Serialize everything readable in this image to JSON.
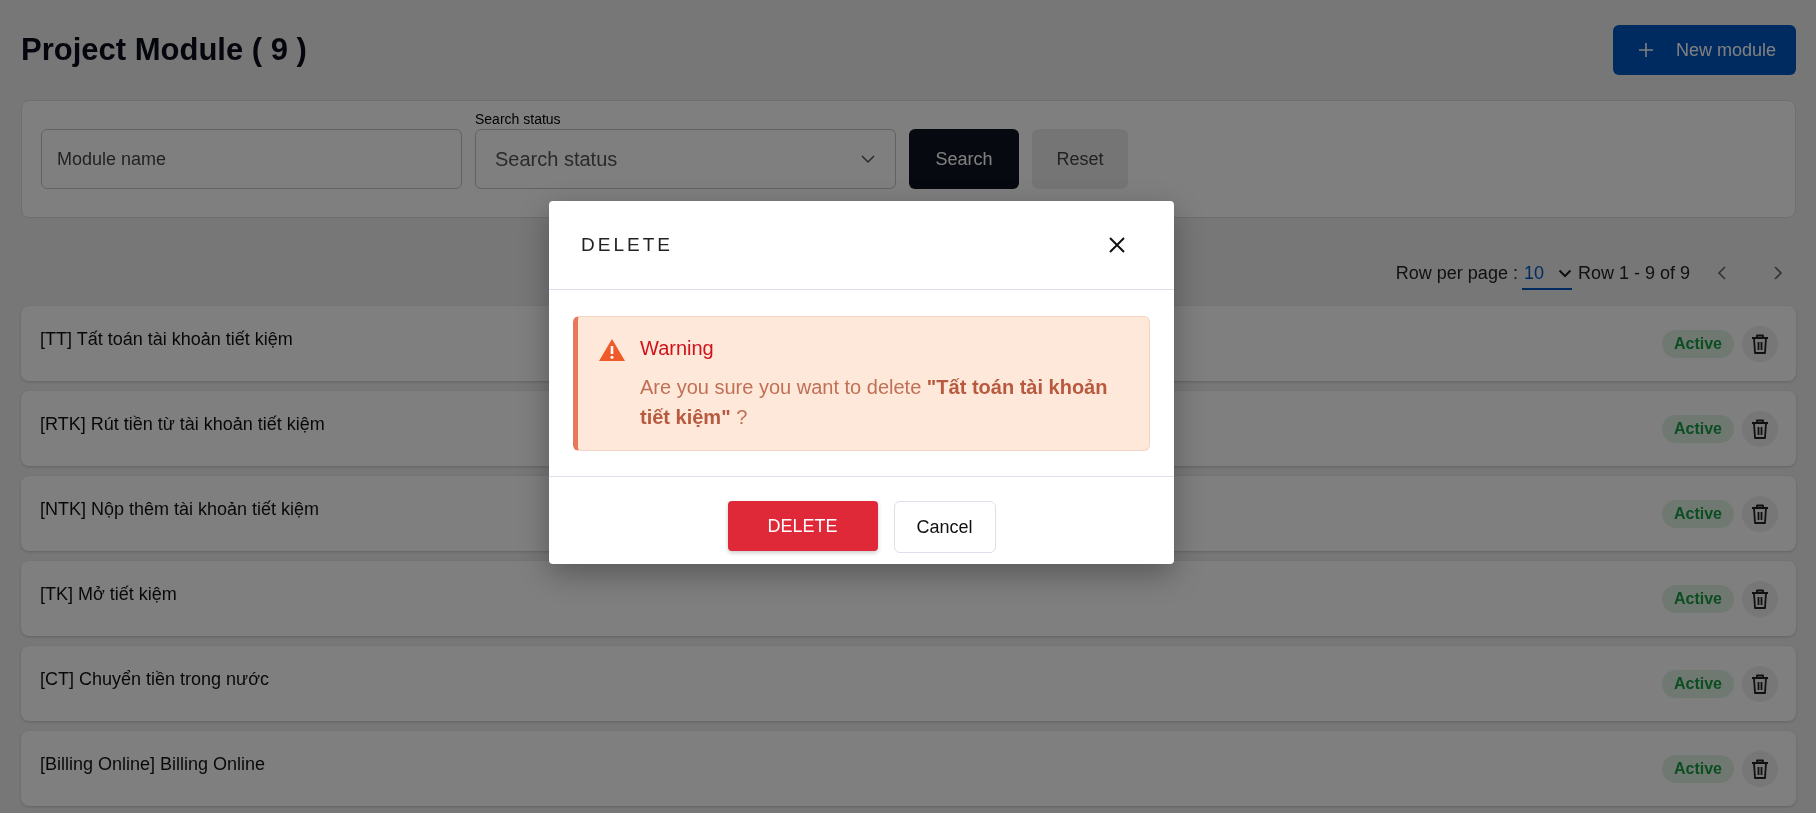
{
  "page": {
    "title": "Project Module ( 9 )",
    "new_button": "New module"
  },
  "filters": {
    "name": {
      "placeholder": "Module name"
    },
    "status": {
      "label": "Search status",
      "placeholder": "Search status"
    },
    "search_button": "Search",
    "reset_button": "Reset"
  },
  "pagination": {
    "label": "Row per page :",
    "per_page": "10",
    "range": "Row 1 - 9 of 9"
  },
  "modules": [
    {
      "name": "[TT] Tất toán tài khoản tiết kiệm",
      "status": "Active"
    },
    {
      "name": "[RTK] Rút tiền từ tài khoản tiết kiệm",
      "status": "Active"
    },
    {
      "name": "[NTK] Nộp thêm tài khoản tiết kiệm",
      "status": "Active"
    },
    {
      "name": "[TK] Mở tiết kiệm",
      "status": "Active"
    },
    {
      "name": "[CT] Chuyển tiền trong nước",
      "status": "Active"
    },
    {
      "name": "[Billing Online] Billing Online",
      "status": "Active"
    }
  ],
  "dialog": {
    "title": "DELETE",
    "alert_title": "Warning",
    "message": "Are you sure you want to delete **\"Tất toán tài khoản tiết kiệm\"** ?",
    "confirm_button": "DELETE",
    "cancel_button": "Cancel"
  }
}
